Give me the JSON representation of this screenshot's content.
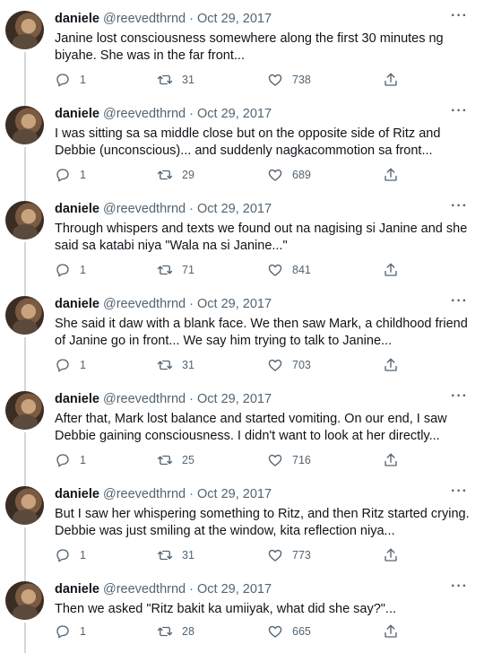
{
  "author": {
    "name": "daniele",
    "handle": "@reevedthrnd",
    "separator": "·",
    "more_icon": "more-horizontal-icon"
  },
  "icons": {
    "reply": "reply-icon",
    "retweet": "retweet-icon",
    "like": "heart-icon",
    "share": "share-icon"
  },
  "colors": {
    "text": "#0f1419",
    "secondary": "#536471",
    "thread_line": "#cfd9de"
  },
  "tweets": [
    {
      "date": "Oct 29, 2017",
      "text": "Janine lost consciousness somewhere along the first 30 minutes ng biyahe. She was in the far front...",
      "replies": "1",
      "retweets": "31",
      "likes": "738"
    },
    {
      "date": "Oct 29, 2017",
      "text": "I was sitting sa sa middle close but on the opposite side of Ritz and Debbie (unconscious)... and suddenly nagkacommotion sa front...",
      "replies": "1",
      "retweets": "29",
      "likes": "689"
    },
    {
      "date": "Oct 29, 2017",
      "text": "Through whispers and texts we found out na nagising si Janine and she said sa katabi niya \"Wala na si Janine...\"",
      "replies": "1",
      "retweets": "71",
      "likes": "841"
    },
    {
      "date": "Oct 29, 2017",
      "text": "She said it daw with a blank face. We then saw Mark, a childhood friend of Janine go in front... We say him trying to talk to Janine...",
      "replies": "1",
      "retweets": "31",
      "likes": "703"
    },
    {
      "date": "Oct 29, 2017",
      "text": "After that, Mark lost balance and started vomiting. On our end, I saw Debbie gaining consciousness. I didn't want to look at her directly...",
      "replies": "1",
      "retweets": "25",
      "likes": "716"
    },
    {
      "date": "Oct 29, 2017",
      "text": "But I saw her whispering something to Ritz, and then Ritz started crying. Debbie was just smiling at the window, kita reflection niya...",
      "replies": "1",
      "retweets": "31",
      "likes": "773"
    },
    {
      "date": "Oct 29, 2017",
      "text": "Then we asked \"Ritz bakit ka umiiyak, what did she say?\"...",
      "replies": "1",
      "retweets": "28",
      "likes": "665"
    }
  ]
}
